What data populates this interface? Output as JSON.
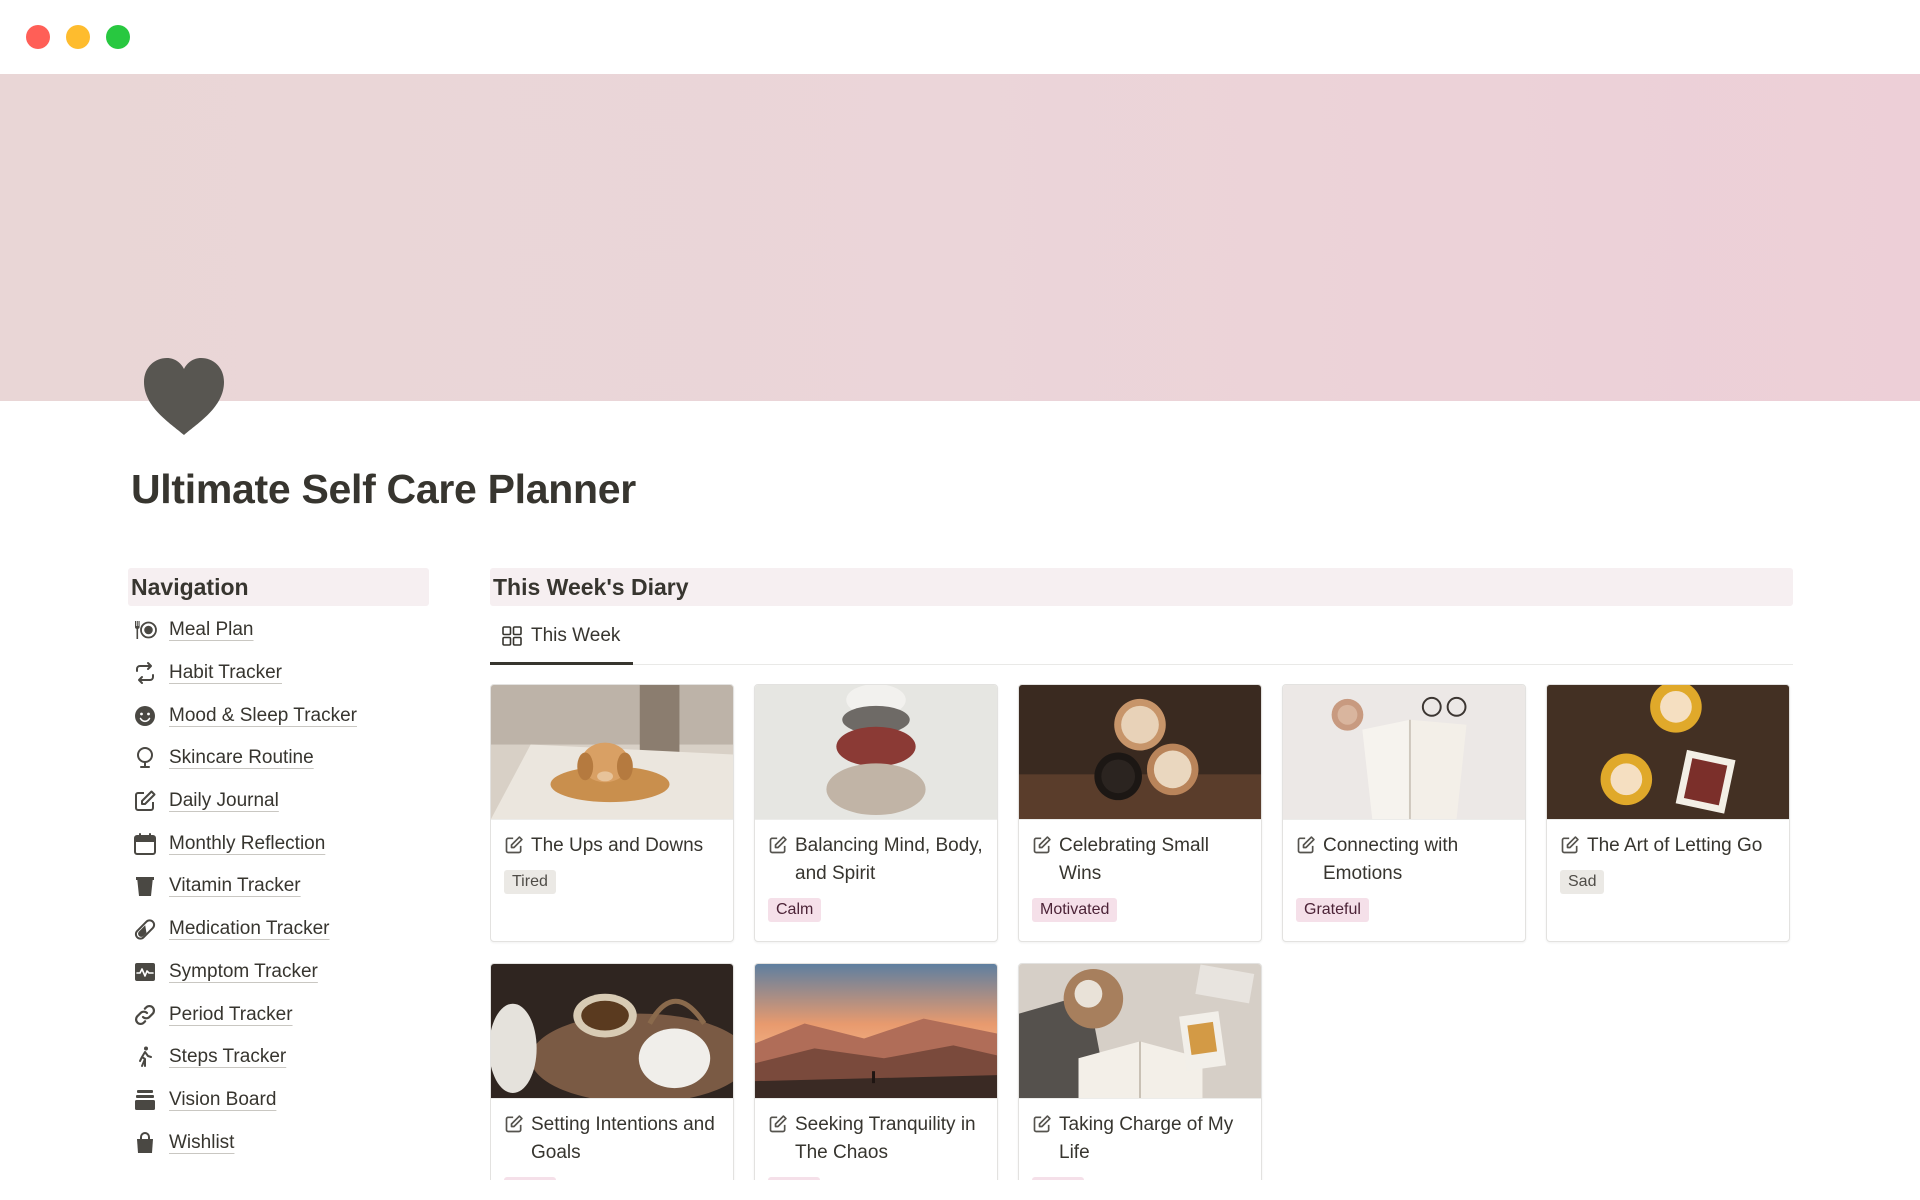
{
  "window": {
    "controls": [
      "close",
      "minimize",
      "zoom"
    ]
  },
  "page": {
    "title": "Ultimate Self Care Planner",
    "icon": "heart-icon",
    "cover_colors": [
      "#e9d6d6",
      "#edcfd7"
    ]
  },
  "navigation": {
    "heading": "Navigation",
    "items": [
      {
        "label": "Meal Plan",
        "icon": "fork-plate-icon"
      },
      {
        "label": "Habit Tracker",
        "icon": "repeat-icon"
      },
      {
        "label": "Mood & Sleep Tracker",
        "icon": "smiley-icon"
      },
      {
        "label": "Skincare Routine",
        "icon": "mirror-icon"
      },
      {
        "label": "Daily Journal",
        "icon": "edit-icon"
      },
      {
        "label": "Monthly Reflection",
        "icon": "calendar-icon"
      },
      {
        "label": "Vitamin Tracker",
        "icon": "cup-icon"
      },
      {
        "label": "Medication Tracker",
        "icon": "pill-icon"
      },
      {
        "label": "Symptom Tracker",
        "icon": "pulse-icon"
      },
      {
        "label": "Period Tracker",
        "icon": "link-icon"
      },
      {
        "label": "Steps Tracker",
        "icon": "walking-icon"
      },
      {
        "label": "Vision Board",
        "icon": "stack-icon"
      },
      {
        "label": "Wishlist",
        "icon": "bag-icon"
      }
    ]
  },
  "diary": {
    "heading": "This Week's Diary",
    "view_tab": "This Week",
    "cards": [
      {
        "title": "The Ups and Downs",
        "tag": "Tired",
        "tag_style": "gray",
        "image": "dog-on-rug"
      },
      {
        "title": "Balancing Mind, Body, and Spirit",
        "tag": "Calm",
        "tag_style": "pink",
        "image": "stacked-stones"
      },
      {
        "title": "Celebrating Small Wins",
        "tag": "Motivated",
        "tag_style": "pink",
        "image": "coffee-cheers"
      },
      {
        "title": "Connecting with Emotions",
        "tag": "Grateful",
        "tag_style": "pink",
        "image": "open-book-glasses"
      },
      {
        "title": "The Art of Letting Go",
        "tag": "Sad",
        "tag_style": "gray",
        "image": "coffee-and-card"
      },
      {
        "title": "Setting Intentions and Goals",
        "tag": "",
        "tag_style": "pink",
        "image": "teapot"
      },
      {
        "title": "Seeking Tranquility in The Chaos",
        "tag": "",
        "tag_style": "pink",
        "image": "mountain-sunset"
      },
      {
        "title": "Taking Charge of My Life",
        "tag": "",
        "tag_style": "pink",
        "image": "cozy-book"
      }
    ]
  }
}
